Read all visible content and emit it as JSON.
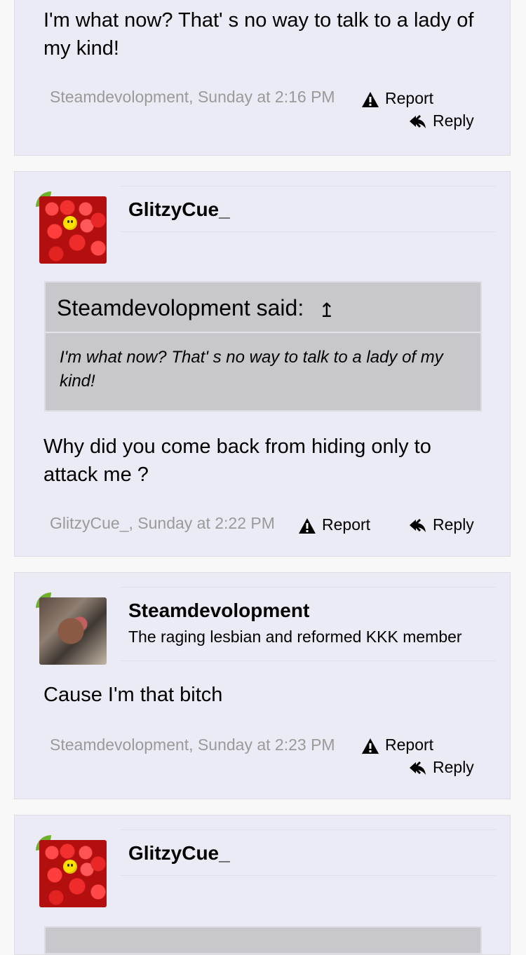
{
  "posts": [
    {
      "message": "I'm what now? That' s no way to talk to a lady of my kind!",
      "meta": "Steamdevolopment, Sunday at 2:16 PM",
      "report_label": "Report",
      "reply_label": "Reply"
    },
    {
      "username": "GlitzyCue_",
      "quote": {
        "author_said": "Steamdevolopment said:",
        "arrow": "↥",
        "text": "I'm what now? That' s no way to talk to a lady of my kind!"
      },
      "message": "Why did you come back from hiding only to attack me ?",
      "meta": "GlitzyCue_, Sunday at 2:22 PM",
      "report_label": "Report",
      "reply_label": "Reply"
    },
    {
      "username": "Steamdevolopment",
      "user_title": "The raging lesbian and reformed KKK member",
      "message": "Cause I'm that bitch",
      "meta": "Steamdevolopment, Sunday at 2:23 PM",
      "report_label": "Report",
      "reply_label": "Reply"
    },
    {
      "username": "GlitzyCue_"
    }
  ],
  "icons": {
    "report": "warning-icon",
    "reply": "reply-icon",
    "leaf": "leaf-icon"
  },
  "colors": {
    "post_background": "#ebebf5",
    "quote_background": "#c8c8cc",
    "meta_text": "#9a9a9a",
    "leaf_accent": "#6fb12a"
  }
}
